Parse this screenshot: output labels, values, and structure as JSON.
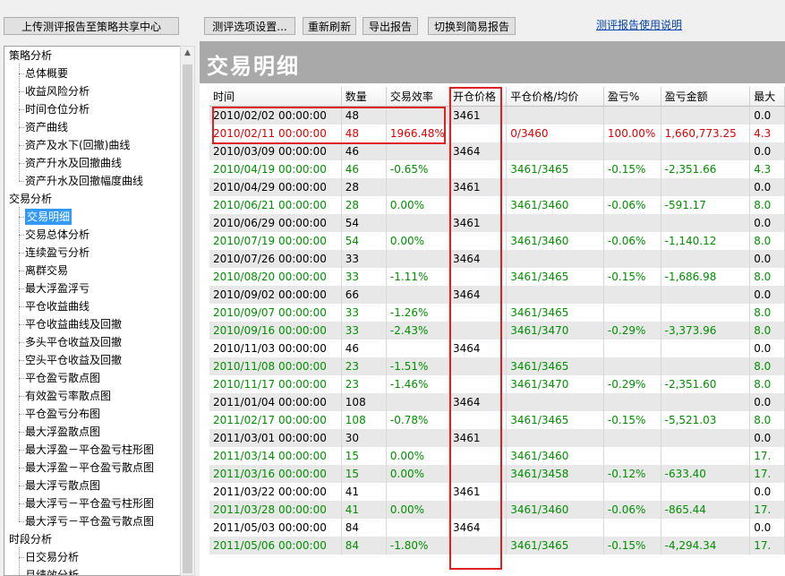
{
  "toolbar": {
    "upload": "上传测评报告至策略共享中心",
    "options": "测评选项设置...",
    "refresh": "重新刷新",
    "export": "导出报告",
    "switch": "切换到简易报告",
    "help": "测评报告使用说明"
  },
  "tree": [
    {
      "label": "策略分析",
      "level": 0
    },
    {
      "label": "总体概要",
      "level": 1
    },
    {
      "label": "收益风险分析",
      "level": 1
    },
    {
      "label": "时间仓位分析",
      "level": 1
    },
    {
      "label": "资产曲线",
      "level": 1
    },
    {
      "label": "资产及水下(回撤)曲线",
      "level": 1
    },
    {
      "label": "资产升水及回撤曲线",
      "level": 1
    },
    {
      "label": "资产升水及回撤幅度曲线",
      "level": 1
    },
    {
      "label": "交易分析",
      "level": 0
    },
    {
      "label": "交易明细",
      "level": 1,
      "selected": true
    },
    {
      "label": "交易总体分析",
      "level": 1
    },
    {
      "label": "连续盈亏分析",
      "level": 1
    },
    {
      "label": "离群交易",
      "level": 1
    },
    {
      "label": "最大浮盈浮亏",
      "level": 1
    },
    {
      "label": "平仓收益曲线",
      "level": 1
    },
    {
      "label": "平仓收益曲线及回撤",
      "level": 1
    },
    {
      "label": "多头平仓收益及回撤",
      "level": 1
    },
    {
      "label": "空头平仓收益及回撤",
      "level": 1
    },
    {
      "label": "平仓盈亏散点图",
      "level": 1
    },
    {
      "label": "有效盈亏率散点图",
      "level": 1
    },
    {
      "label": "平仓盈亏分布图",
      "level": 1
    },
    {
      "label": "最大浮盈散点图",
      "level": 1
    },
    {
      "label": "最大浮盈－平仓盈亏柱形图",
      "level": 1
    },
    {
      "label": "最大浮盈－平仓盈亏散点图",
      "level": 1
    },
    {
      "label": "最大浮亏散点图",
      "level": 1
    },
    {
      "label": "最大浮亏－平仓盈亏柱形图",
      "level": 1
    },
    {
      "label": "最大浮亏－平仓盈亏散点图",
      "level": 1
    },
    {
      "label": "时段分析",
      "level": 0
    },
    {
      "label": "日交易分析",
      "level": 1
    },
    {
      "label": "月绩效分析",
      "level": 1
    }
  ],
  "page_title": "交易明细",
  "table": {
    "headers": [
      "时间",
      "数量",
      "交易效率",
      "开仓价格",
      "平仓价格/均价",
      "盈亏%",
      "盈亏金额",
      "最大"
    ],
    "rows": [
      {
        "color": "black",
        "cells": [
          "2010/02/02 00:00:00",
          "48",
          "",
          "3461",
          "",
          "",
          "",
          "0.0"
        ]
      },
      {
        "color": "red",
        "cells": [
          "2010/02/11 00:00:00",
          "48",
          "1966.48%",
          "",
          "0/3460",
          "100.00%",
          "1,660,773.25",
          "4.3"
        ]
      },
      {
        "color": "black",
        "cells": [
          "2010/03/09 00:00:00",
          "46",
          "",
          "3464",
          "",
          "",
          "",
          "0.0"
        ]
      },
      {
        "color": "green",
        "cells": [
          "2010/04/19 00:00:00",
          "46",
          "-0.65%",
          "",
          "3461/3465",
          "-0.15%",
          "-2,351.66",
          "4.3"
        ]
      },
      {
        "color": "black",
        "cells": [
          "2010/04/29 00:00:00",
          "28",
          "",
          "3461",
          "",
          "",
          "",
          "0.0"
        ]
      },
      {
        "color": "green",
        "cells": [
          "2010/06/21 00:00:00",
          "28",
          "0.00%",
          "",
          "3461/3460",
          "-0.06%",
          "-591.17",
          "8.0"
        ]
      },
      {
        "color": "black",
        "cells": [
          "2010/06/29 00:00:00",
          "54",
          "",
          "3461",
          "",
          "",
          "",
          "0.0"
        ]
      },
      {
        "color": "green",
        "cells": [
          "2010/07/19 00:00:00",
          "54",
          "0.00%",
          "",
          "3461/3460",
          "-0.06%",
          "-1,140.12",
          "8.0"
        ]
      },
      {
        "color": "black",
        "cells": [
          "2010/07/26 00:00:00",
          "33",
          "",
          "3464",
          "",
          "",
          "",
          "0.0"
        ]
      },
      {
        "color": "green",
        "cells": [
          "2010/08/20 00:00:00",
          "33",
          "-1.11%",
          "",
          "3461/3465",
          "-0.15%",
          "-1,686.98",
          "8.0"
        ]
      },
      {
        "color": "black",
        "cells": [
          "2010/09/02 00:00:00",
          "66",
          "",
          "3464",
          "",
          "",
          "",
          "0.0"
        ]
      },
      {
        "color": "green",
        "cells": [
          "2010/09/07 00:00:00",
          "33",
          "-1.26%",
          "",
          "3461/3465",
          "",
          "",
          "8.0"
        ]
      },
      {
        "color": "green",
        "cells": [
          "2010/09/16 00:00:00",
          "33",
          "-2.43%",
          "",
          "3461/3470",
          "-0.29%",
          "-3,373.96",
          "8.0"
        ]
      },
      {
        "color": "black",
        "cells": [
          "2010/11/03 00:00:00",
          "46",
          "",
          "3464",
          "",
          "",
          "",
          "0.0"
        ]
      },
      {
        "color": "green",
        "cells": [
          "2010/11/08 00:00:00",
          "23",
          "-1.51%",
          "",
          "3461/3465",
          "",
          "",
          "8.0"
        ]
      },
      {
        "color": "green",
        "cells": [
          "2010/11/17 00:00:00",
          "23",
          "-1.46%",
          "",
          "3461/3470",
          "-0.29%",
          "-2,351.60",
          "8.0"
        ]
      },
      {
        "color": "black",
        "cells": [
          "2011/01/04 00:00:00",
          "108",
          "",
          "3464",
          "",
          "",
          "",
          "0.0"
        ]
      },
      {
        "color": "green",
        "cells": [
          "2011/02/17 00:00:00",
          "108",
          "-0.78%",
          "",
          "3461/3465",
          "-0.15%",
          "-5,521.03",
          "8.0"
        ]
      },
      {
        "color": "black",
        "cells": [
          "2011/03/01 00:00:00",
          "30",
          "",
          "3461",
          "",
          "",
          "",
          "0.0"
        ]
      },
      {
        "color": "green",
        "cells": [
          "2011/03/14 00:00:00",
          "15",
          "0.00%",
          "",
          "3461/3460",
          "",
          "",
          "17."
        ]
      },
      {
        "color": "green",
        "cells": [
          "2011/03/16 00:00:00",
          "15",
          "0.00%",
          "",
          "3461/3458",
          "-0.12%",
          "-633.40",
          "17."
        ]
      },
      {
        "color": "black",
        "cells": [
          "2011/03/22 00:00:00",
          "41",
          "",
          "3461",
          "",
          "",
          "",
          "0.0"
        ]
      },
      {
        "color": "green",
        "cells": [
          "2011/03/28 00:00:00",
          "41",
          "0.00%",
          "",
          "3461/3460",
          "-0.06%",
          "-865.44",
          "17."
        ]
      },
      {
        "color": "black",
        "cells": [
          "2011/05/03 00:00:00",
          "84",
          "",
          "3464",
          "",
          "",
          "",
          "0.0"
        ]
      },
      {
        "color": "green",
        "cells": [
          "2011/05/06 00:00:00",
          "84",
          "-1.80%",
          "",
          "3461/3465",
          "-0.15%",
          "-4,294.34",
          "17."
        ]
      }
    ]
  }
}
